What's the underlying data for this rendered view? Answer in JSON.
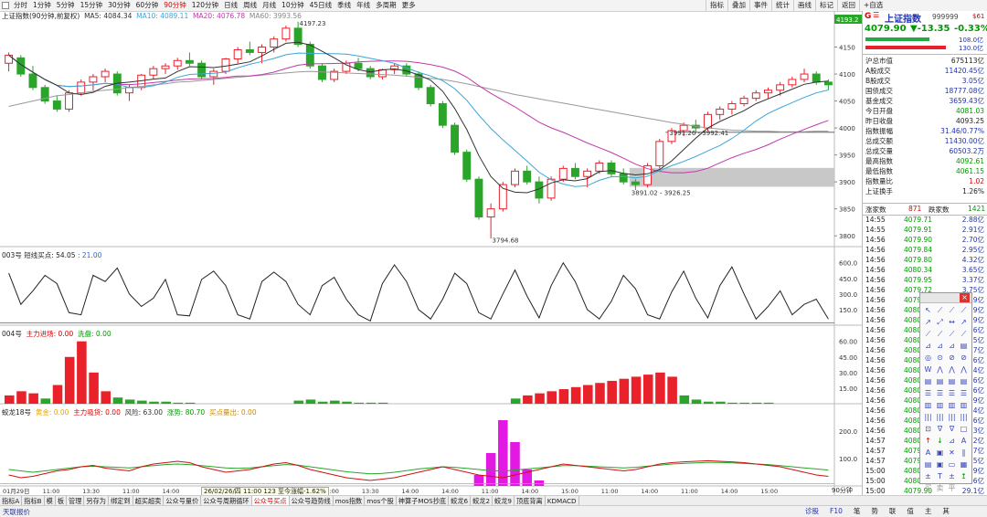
{
  "topbar": {
    "periods": [
      "分时",
      "1分钟",
      "5分钟",
      "15分钟",
      "30分钟",
      "60分钟",
      "90分钟",
      "120分钟",
      "日线",
      "周线",
      "月线",
      "10分钟",
      "45日线",
      "季线",
      "年线",
      "多周期",
      "更多"
    ],
    "active_period": "90分钟",
    "toolbar": [
      "指标",
      "叠加",
      "事件",
      "统计",
      "画线",
      "标记",
      "返回"
    ],
    "self_select": "+自选",
    "close": "X"
  },
  "main_chart": {
    "legend_name": "上证指数(90分钟,前复权)",
    "ma5": "MA5: 4084.34",
    "ma10": "MA10: 4089.11",
    "ma20": "MA20: 4076.78",
    "ma60": "MA60: 3993.56",
    "high_label": "4197.23",
    "low_label": "3794.68",
    "range1": "3991.26 - 3992.41",
    "range2": "3891.02 - 3926.25",
    "yticks": [
      "4150",
      "4100",
      "4050",
      "4000",
      "3950",
      "3900",
      "3850",
      "3800"
    ],
    "current_tag": "4193.2"
  },
  "panel1": {
    "name": "003号 短线买点: 54.05",
    "val2": "21.00",
    "yticks": [
      "600.0",
      "450.0",
      "300.0",
      "150.0"
    ]
  },
  "panel2": {
    "name": "004号",
    "inflow": "主力进场: 0.00",
    "outflow": "洗盘: 0.00",
    "yticks": [
      "60.00",
      "45.00",
      "30.00",
      "15.00"
    ]
  },
  "panel3": {
    "name": "蛟龙18号",
    "a": "黄金: 0.00",
    "b": "主力吸货: 0.00",
    "c": "风险: 63.00",
    "d": "涨势: 80.70",
    "e": "买点量出: 0.00",
    "yticks": [
      "200.0",
      "100.0"
    ]
  },
  "xaxis": {
    "labels": [
      "01月29日",
      "11:00",
      "13:30",
      "11:00",
      "14:00",
      "14:00",
      "11:00",
      "14:00",
      "11:00",
      "13:30",
      "14:00",
      "14:00",
      "11:00",
      "14:00",
      "15:00",
      "11:00",
      "14:00",
      "11:00",
      "14:00",
      "15:00"
    ],
    "hover": "26/02/26/四 11:00 123 至今涨幅-1.62%",
    "period_tag": "90分钟"
  },
  "bottom_tabs": [
    "指标A",
    "指标B",
    "模",
    "板",
    "管理",
    "另存为",
    "绑定到",
    "超买超卖",
    "公众号量价",
    "公众号周期循环",
    "公众号买点",
    "公众号趋势线",
    "mos指数",
    "mos个股",
    "神算子MOS抄底",
    "蛟龙6",
    "蛟龙2",
    "蛟龙9",
    "顶底背离",
    "KDMACD"
  ],
  "active_bottom_tab": "公众号买点",
  "status": {
    "left": "天联报价",
    "right_items": [
      "诊股",
      "F10",
      "笔",
      "势",
      "联",
      "值",
      "主",
      "其"
    ]
  },
  "right_panel": {
    "logo": "G",
    "title": "上证指数",
    "code": "999999",
    "flag": "$61",
    "price": "4079.90",
    "change": "▼-13.35",
    "pct": "-0.33%",
    "bar1": "108.0亿",
    "bar2": "130.0亿",
    "stats": [
      {
        "label": "沪总市值",
        "value": "675113亿",
        "cls": ""
      },
      {
        "label": "A股成交",
        "value": "11420.45亿",
        "cls": "blue"
      },
      {
        "label": "B股成交",
        "value": "3.05亿",
        "cls": "blue"
      },
      {
        "label": "国债成交",
        "value": "18777.08亿",
        "cls": "blue"
      },
      {
        "label": "基金成交",
        "value": "3659.43亿",
        "cls": "blue"
      },
      {
        "label": "今日开盘",
        "value": "4081.03",
        "cls": "dn"
      },
      {
        "label": "昨日收盘",
        "value": "4093.25",
        "cls": ""
      },
      {
        "label": "指数振幅",
        "value": "31.46/0.77%",
        "cls": "blue"
      },
      {
        "label": "总成交额",
        "value": "11430.00亿",
        "cls": "blue"
      },
      {
        "label": "总成交量",
        "value": "60503.2万",
        "cls": "blue"
      },
      {
        "label": "最高指数",
        "value": "4092.61",
        "cls": "dn"
      },
      {
        "label": "最低指数",
        "value": "4061.15",
        "cls": "dn"
      },
      {
        "label": "指数量比",
        "value": "1.02",
        "cls": "up"
      },
      {
        "label": "上证换手",
        "value": "1.26%",
        "cls": ""
      }
    ],
    "up_label": "涨家数",
    "up_count": "871",
    "dn_label": "跌家数",
    "dn_count": "1421",
    "ticks": [
      {
        "t": "14:55",
        "p": "4079.71",
        "v": "2.88亿"
      },
      {
        "t": "14:55",
        "p": "4079.91",
        "v": "2.91亿"
      },
      {
        "t": "14:56",
        "p": "4079.90",
        "v": "2.70亿"
      },
      {
        "t": "14:56",
        "p": "4079.84",
        "v": "2.95亿"
      },
      {
        "t": "14:56",
        "p": "4079.80",
        "v": "4.32亿"
      },
      {
        "t": "14:56",
        "p": "4080.34",
        "v": "3.65亿"
      },
      {
        "t": "14:56",
        "p": "4079.95",
        "v": "3.37亿"
      },
      {
        "t": "14:56",
        "p": "4079.72",
        "v": "3.75亿"
      },
      {
        "t": "14:56",
        "p": "4079",
        "v": "3.49亿"
      },
      {
        "t": "14:56",
        "p": "4080",
        "v": "3.19亿"
      },
      {
        "t": "14:56",
        "p": "4080",
        "v": "2.9亿"
      },
      {
        "t": "14:56",
        "p": "4080",
        "v": "2.6亿"
      },
      {
        "t": "14:56",
        "p": "4080",
        "v": "2.5亿"
      },
      {
        "t": "14:56",
        "p": "4080",
        "v": "2.7亿"
      },
      {
        "t": "14:56",
        "p": "4080",
        "v": "2.6亿"
      },
      {
        "t": "14:56",
        "p": "4080",
        "v": "2.4亿"
      },
      {
        "t": "14:56",
        "p": "4080",
        "v": "2.6亿"
      },
      {
        "t": "14:56",
        "p": "4080",
        "v": "2.6亿"
      },
      {
        "t": "14:56",
        "p": "4080",
        "v": "2.9亿"
      },
      {
        "t": "14:56",
        "p": "4080",
        "v": "2.4亿"
      },
      {
        "t": "14:56",
        "p": "4080",
        "v": "2.6亿"
      },
      {
        "t": "14:56",
        "p": "4080",
        "v": "2.3亿"
      },
      {
        "t": "14:57",
        "p": "4080",
        "v": "2.2亿"
      },
      {
        "t": "14:57",
        "p": "4079",
        "v": "2.7亿"
      },
      {
        "t": "14:57",
        "p": "4079",
        "v": "2.5亿"
      },
      {
        "t": "15:00",
        "p": "4080",
        "v": "2.9亿"
      },
      {
        "t": "15:00",
        "p": "4080",
        "v": "2.6亿"
      },
      {
        "t": "15:00",
        "p": "4079.90",
        "v": "29.1亿"
      }
    ]
  },
  "palette": {
    "close": "×",
    "icons": [
      "↖",
      "⟋",
      "⟋",
      "⟋",
      "↗",
      "⤢",
      "↔",
      "↗",
      "⟋",
      "⟋",
      "⟋",
      "⟋",
      "⊿",
      "⊿",
      "⊿",
      "▤",
      "◎",
      "⊙",
      "⊘",
      "⊘",
      "W",
      "⋀",
      "⋀",
      "⋀",
      "▤",
      "▤",
      "▤",
      "▤",
      "☰",
      "☰",
      "☰",
      "☰",
      "▥",
      "▥",
      "▥",
      "▥",
      "|||",
      "|||",
      "|||",
      "|||",
      "⊡",
      "∇",
      "∇",
      "□",
      "↑",
      "↓",
      "⊿",
      "A",
      "A",
      "▣",
      "✕",
      "∥",
      "▤",
      "▣",
      "▭",
      "▦",
      "±",
      "T",
      "±",
      "↥",
      "买",
      "卖",
      "平",
      ""
    ]
  },
  "colors": {
    "up": "#e8212b",
    "down": "#2aa52a",
    "ma5": "#333333",
    "ma10": "#3ba7d8",
    "ma20": "#c03aa8",
    "ma60": "#999999",
    "magenta": "#e219e2"
  },
  "chart_data": {
    "type": "candlestick",
    "title": "上证指数(90分钟,前复权)",
    "note": "price candles per 90-minute bar",
    "ylim": [
      3780,
      4200
    ],
    "candles": [
      [
        4120,
        4140,
        4105,
        4135
      ],
      [
        4130,
        4135,
        4095,
        4100
      ],
      [
        4100,
        4115,
        4070,
        4075
      ],
      [
        4075,
        4080,
        4045,
        4050
      ],
      [
        4050,
        4060,
        4030,
        4035
      ],
      [
        4035,
        4070,
        4030,
        4065
      ],
      [
        4065,
        4090,
        4060,
        4085
      ],
      [
        4085,
        4100,
        4070,
        4095
      ],
      [
        4095,
        4110,
        4085,
        4105
      ],
      [
        4100,
        4105,
        4060,
        4065
      ],
      [
        4065,
        4080,
        4050,
        4075
      ],
      [
        4075,
        4100,
        4070,
        4098
      ],
      [
        4098,
        4115,
        4090,
        4110
      ],
      [
        4110,
        4120,
        4100,
        4115
      ],
      [
        4115,
        4130,
        4108,
        4125
      ],
      [
        4125,
        4140,
        4115,
        4120
      ],
      [
        4120,
        4125,
        4090,
        4095
      ],
      [
        4095,
        4110,
        4080,
        4105
      ],
      [
        4105,
        4130,
        4100,
        4128
      ],
      [
        4128,
        4150,
        4120,
        4145
      ],
      [
        4145,
        4160,
        4135,
        4140
      ],
      [
        4140,
        4155,
        4120,
        4150
      ],
      [
        4150,
        4170,
        4140,
        4165
      ],
      [
        4165,
        4190,
        4160,
        4185
      ],
      [
        4185,
        4197,
        4150,
        4155
      ],
      [
        4155,
        4160,
        4110,
        4115
      ],
      [
        4115,
        4120,
        4085,
        4090
      ],
      [
        4090,
        4110,
        4085,
        4105
      ],
      [
        4105,
        4125,
        4100,
        4120
      ],
      [
        4120,
        4130,
        4105,
        4110
      ],
      [
        4110,
        4115,
        4090,
        4095
      ],
      [
        4095,
        4110,
        4090,
        4108
      ],
      [
        4108,
        4120,
        4100,
        4115
      ],
      [
        4115,
        4120,
        4095,
        4100
      ],
      [
        4100,
        4105,
        4070,
        4075
      ],
      [
        4075,
        4080,
        4040,
        4045
      ],
      [
        4045,
        4050,
        4000,
        4005
      ],
      [
        4005,
        4010,
        3950,
        3955
      ],
      [
        3955,
        3960,
        3900,
        3905
      ],
      [
        3905,
        3910,
        3830,
        3835
      ],
      [
        3835,
        3860,
        3795,
        3850
      ],
      [
        3850,
        3900,
        3845,
        3895
      ],
      [
        3895,
        3925,
        3890,
        3920
      ],
      [
        3920,
        3930,
        3895,
        3900
      ],
      [
        3900,
        3910,
        3860,
        3870
      ],
      [
        3870,
        3910,
        3865,
        3905
      ],
      [
        3905,
        3930,
        3900,
        3925
      ],
      [
        3925,
        3935,
        3905,
        3910
      ],
      [
        3910,
        3925,
        3890,
        3920
      ],
      [
        3920,
        3940,
        3915,
        3935
      ],
      [
        3935,
        3940,
        3910,
        3915
      ],
      [
        3915,
        3925,
        3895,
        3900
      ],
      [
        3900,
        3905,
        3885,
        3895
      ],
      [
        3895,
        3935,
        3890,
        3930
      ],
      [
        3930,
        3980,
        3925,
        3975
      ],
      [
        3975,
        4000,
        3970,
        3995
      ],
      [
        3995,
        4010,
        3985,
        4005
      ],
      [
        4005,
        4015,
        3990,
        4000
      ],
      [
        4000,
        4030,
        3995,
        4025
      ],
      [
        4025,
        4040,
        4015,
        4035
      ],
      [
        4035,
        4050,
        4025,
        4045
      ],
      [
        4045,
        4060,
        4040,
        4055
      ],
      [
        4055,
        4070,
        4050,
        4065
      ],
      [
        4065,
        4075,
        4055,
        4070
      ],
      [
        4070,
        4085,
        4060,
        4080
      ],
      [
        4080,
        4095,
        4075,
        4090
      ],
      [
        4090,
        4110,
        4085,
        4100
      ],
      [
        4100,
        4105,
        4080,
        4085
      ],
      [
        4085,
        4090,
        4070,
        4080
      ]
    ],
    "ma60": [
      4040,
      4045,
      4050,
      4055,
      4060,
      4062,
      4065,
      4068,
      4070,
      4072,
      4075,
      4077,
      4080,
      4082,
      4085,
      4086,
      4088,
      4090,
      4092,
      4094,
      4096,
      4098,
      4100,
      4102,
      4104,
      4105,
      4104,
      4103,
      4102,
      4101,
      4100,
      4099,
      4098,
      4096,
      4094,
      4092,
      4090,
      4086,
      4082,
      4077,
      4072,
      4067,
      4062,
      4058,
      4054,
      4050,
      4046,
      4042,
      4038,
      4034,
      4030,
      4026,
      4022,
      4018,
      4014,
      4010,
      4007,
      4003,
      4000,
      3998,
      3996,
      3995,
      3994,
      3994,
      3993,
      3993,
      3993,
      3994,
      3994
    ],
    "p1_line": [
      500,
      200,
      330,
      480,
      400,
      120,
      100,
      480,
      420,
      550,
      300,
      180,
      260,
      440,
      100,
      90,
      440,
      520,
      380,
      100,
      60,
      420,
      510,
      420,
      200,
      100,
      380,
      460,
      250,
      100,
      40,
      400,
      580,
      420,
      150,
      60,
      250,
      500,
      400,
      120,
      60,
      300,
      530,
      280,
      70,
      380,
      600,
      420,
      150,
      60,
      230,
      480,
      350,
      100,
      60,
      320,
      520,
      260,
      70,
      380,
      560,
      300,
      60,
      180,
      330,
      100,
      200,
      250,
      60,
      80
    ],
    "p2_bars": [
      8,
      12,
      10,
      5,
      18,
      45,
      60,
      30,
      12,
      6,
      4,
      3,
      2,
      2,
      1,
      1,
      0,
      0,
      0,
      0,
      0,
      0,
      0,
      0,
      3,
      4,
      2,
      3,
      2,
      1,
      1,
      1,
      0,
      0,
      0,
      0,
      0,
      0,
      0,
      0,
      0,
      0,
      5,
      8,
      10,
      12,
      14,
      16,
      18,
      20,
      22,
      24,
      26,
      28,
      30,
      26,
      8,
      4,
      2,
      2,
      1,
      1,
      1,
      1,
      0,
      0,
      0,
      0,
      0
    ],
    "p2_colors": "r",
    "p3_red": [
      40,
      30,
      35,
      45,
      55,
      60,
      70,
      75,
      65,
      60,
      55,
      70,
      80,
      85,
      90,
      85,
      70,
      60,
      50,
      55,
      60,
      70,
      80,
      85,
      75,
      60,
      50,
      40,
      30,
      25,
      20,
      25,
      30,
      40,
      50,
      60,
      70,
      60,
      50,
      40,
      35,
      30,
      40,
      50,
      60,
      70,
      80,
      75,
      70,
      65,
      60,
      55,
      60,
      70,
      80,
      85,
      88,
      90,
      92,
      90,
      88,
      85,
      80,
      75,
      70,
      60,
      50,
      40,
      35
    ],
    "p3_green": [
      60,
      55,
      50,
      55,
      60,
      65,
      70,
      72,
      70,
      68,
      66,
      70,
      74,
      78,
      80,
      78,
      74,
      70,
      66,
      64,
      66,
      70,
      74,
      78,
      76,
      70,
      64,
      58,
      52,
      48,
      44,
      46,
      50,
      56,
      62,
      66,
      70,
      68,
      64,
      60,
      56,
      54,
      58,
      62,
      66,
      70,
      74,
      74,
      72,
      70,
      68,
      66,
      68,
      72,
      76,
      80,
      82,
      84,
      86,
      86,
      84,
      82,
      80,
      78,
      74,
      70,
      66,
      62,
      58
    ],
    "p3_pink": [
      0,
      0,
      0,
      0,
      0,
      0,
      0,
      0,
      0,
      0,
      0,
      0,
      0,
      0,
      0,
      0,
      0,
      0,
      0,
      0,
      0,
      0,
      0,
      0,
      0,
      0,
      0,
      0,
      0,
      0,
      0,
      0,
      0,
      0,
      0,
      0,
      0,
      0,
      0,
      40,
      120,
      240,
      160,
      60,
      20,
      0,
      0,
      0,
      0,
      0,
      0,
      0,
      0,
      0,
      0,
      0,
      0,
      0,
      0,
      0,
      0,
      0,
      0,
      0,
      0,
      0,
      0,
      0,
      0
    ]
  }
}
